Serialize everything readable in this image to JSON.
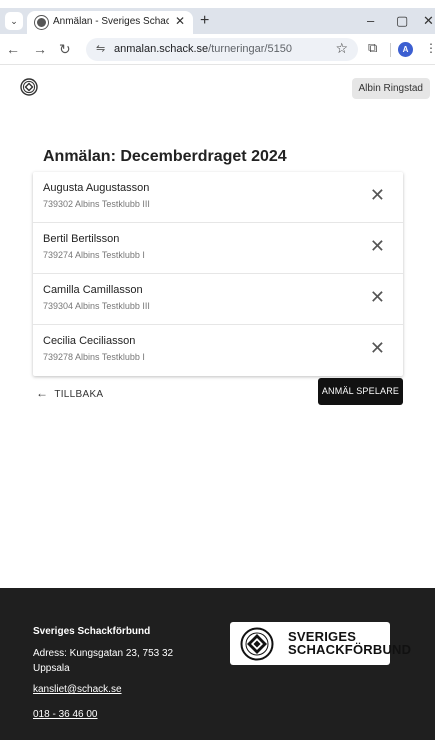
{
  "browser": {
    "tab_title": "Anmälan - Sveriges Schackförb",
    "url_host": "anmalan.schack.se",
    "url_path": "/turneringar/5150",
    "profile_initial": "A"
  },
  "header": {
    "user_name": "Albin Ringstad"
  },
  "page": {
    "title": "Anmälan: Decemberdraget 2024"
  },
  "players": [
    {
      "name": "Augusta Augustasson",
      "meta": "739302 Albins Testklubb III"
    },
    {
      "name": "Bertil Bertilsson",
      "meta": "739274 Albins Testklubb I"
    },
    {
      "name": "Camilla Camillasson",
      "meta": "739304 Albins Testklubb III"
    },
    {
      "name": "Cecilia Ceciliasson",
      "meta": "739278 Albins Testklubb I"
    }
  ],
  "actions": {
    "back_label": "TILLBAKA",
    "register_label": "ANMÄL SPELARE"
  },
  "footer": {
    "org_name": "Sveriges Schackförbund",
    "address": "Adress: Kungsgatan 23, 753 32 Uppsala",
    "email": "kansliet@schack.se",
    "phone": "018 - 36 46 00",
    "logo_line1": "SVERIGES",
    "logo_line2": "SCHACKFÖRBUND"
  },
  "colors": {
    "accent": "#111111",
    "footer_bg": "#1f1f1f",
    "user_btn_bg": "#e6e6e6"
  }
}
